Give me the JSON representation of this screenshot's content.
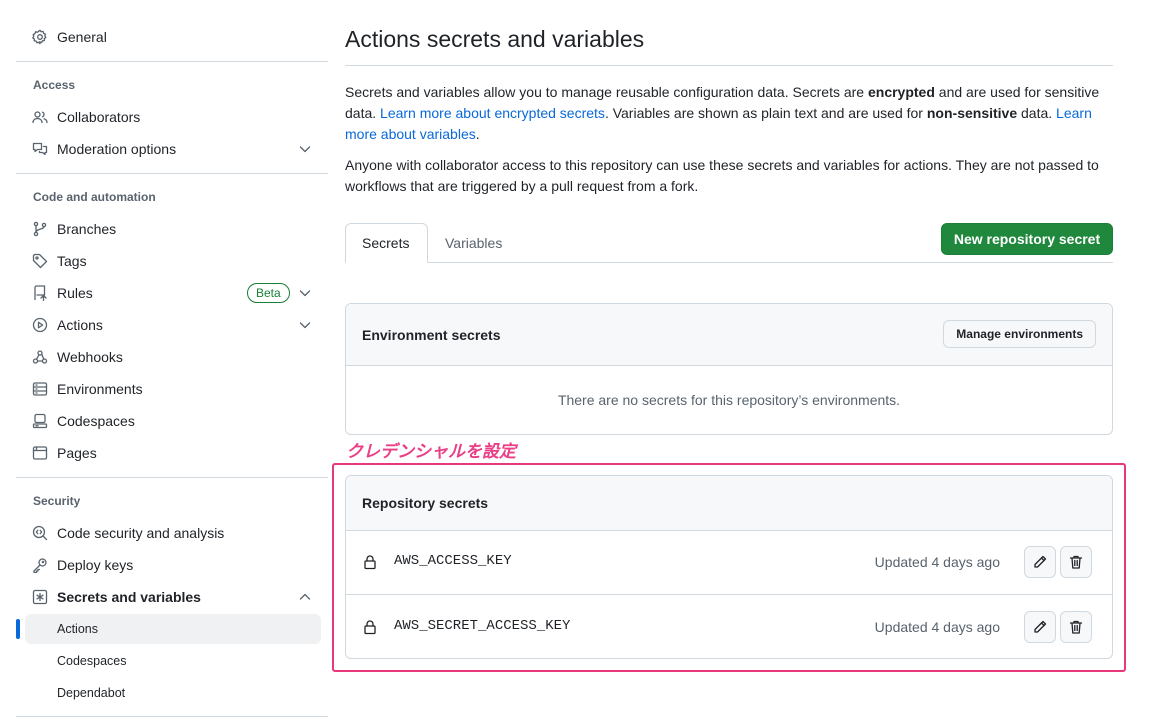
{
  "sidebar": {
    "general": "General",
    "sections": {
      "access": "Access",
      "code_automation": "Code and automation",
      "security": "Security"
    },
    "items": {
      "collaborators": "Collaborators",
      "moderation": "Moderation options",
      "branches": "Branches",
      "tags": "Tags",
      "rules": "Rules",
      "rules_badge": "Beta",
      "actions": "Actions",
      "webhooks": "Webhooks",
      "environments": "Environments",
      "codespaces": "Codespaces",
      "pages": "Pages",
      "code_security": "Code security and analysis",
      "deploy_keys": "Deploy keys",
      "secrets_variables": "Secrets and variables"
    },
    "sub_items": {
      "actions": "Actions",
      "codespaces": "Codespaces",
      "dependabot": "Dependabot"
    },
    "active_accent": "#0969da"
  },
  "main": {
    "title": "Actions secrets and variables",
    "intro": {
      "t1": "Secrets and variables allow you to manage reusable configuration data. Secrets are ",
      "b1": "encrypted",
      "t2": " and are used for sensitive data. ",
      "link1": "Learn more about encrypted secrets",
      "t3": ". Variables are shown as plain text and are used for ",
      "b2": "non-sensitive",
      "t4": " data. ",
      "link2": "Learn more about variables",
      "t5": "."
    },
    "access_note": "Anyone with collaborator access to this repository can use these secrets and variables for actions. They are not passed to workflows that are triggered by a pull request from a fork.",
    "tabs": [
      "Secrets",
      "Variables"
    ],
    "new_secret_button": "New repository secret",
    "primary_color": "#1f883d",
    "environment_secrets": {
      "heading": "Environment secrets",
      "manage_button": "Manage environments",
      "empty_text": "There are no secrets for this repository’s environments."
    },
    "repository_secrets": {
      "heading": "Repository secrets",
      "rows": [
        {
          "name": "AWS_ACCESS_KEY",
          "updated": "Updated 4 days ago"
        },
        {
          "name": "AWS_SECRET_ACCESS_KEY",
          "updated": "Updated 4 days ago"
        }
      ]
    }
  },
  "annotation": {
    "text": "クレデンシャルを設定",
    "color": "#e8377b"
  }
}
